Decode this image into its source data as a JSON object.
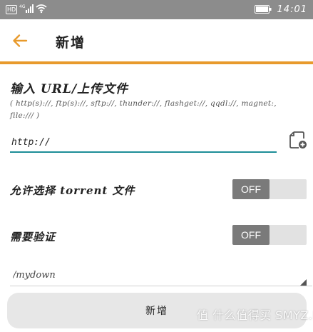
{
  "status_bar": {
    "network_badge": "HD",
    "signal_label": "4G",
    "time": "14:01",
    "icons": [
      "hd-icon",
      "signal-icon",
      "wifi-icon",
      "battery-icon"
    ]
  },
  "app_bar": {
    "title": "新增",
    "back_icon": "arrow-left-icon",
    "accent_color": "#e89a2c"
  },
  "url_section": {
    "title": "输入 URL/上传文件",
    "hint": "( http(s)://, ftp(s)://, sftp://, thunder://, flashget://, qqdl://, magnet:, file:/// )",
    "input_value": "http://",
    "upload_icon": "add-file-icon",
    "underline_color": "#1d8e98"
  },
  "toggles": [
    {
      "label": "允许选择 torrent 文件",
      "state": "OFF"
    },
    {
      "label": "需要验证",
      "state": "OFF"
    }
  ],
  "path_field": {
    "value": "/mydown"
  },
  "submit": {
    "label": "新增"
  },
  "watermark": {
    "text": "值 什么值得买 SMYZ.NET"
  }
}
